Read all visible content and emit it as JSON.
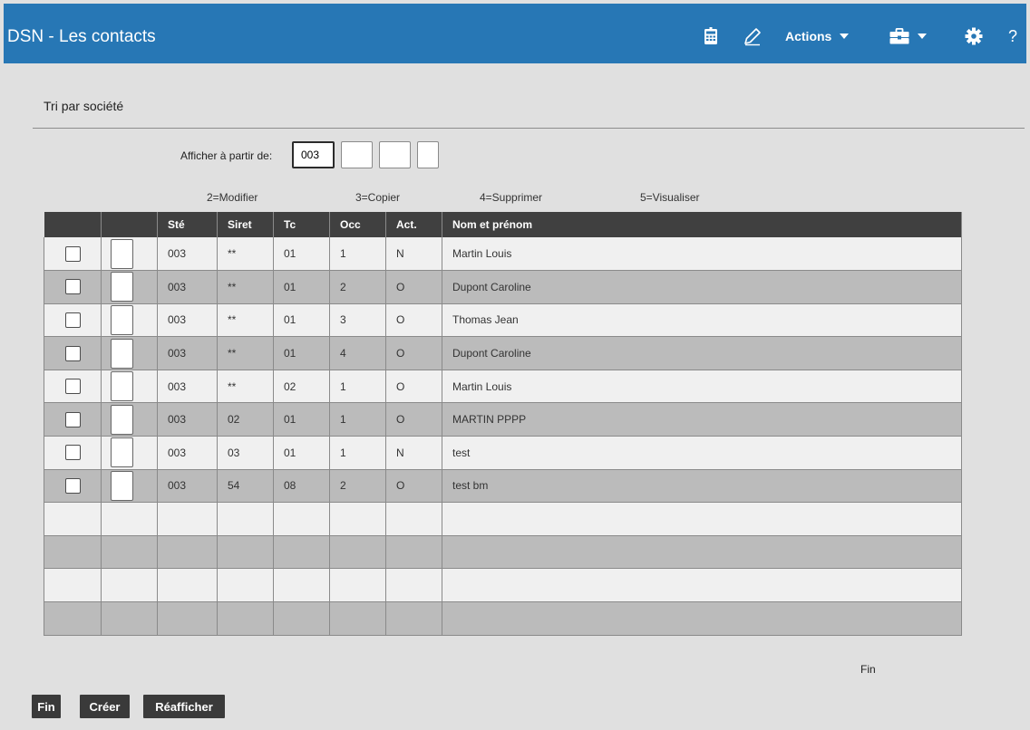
{
  "header": {
    "title": "DSN - Les contacts",
    "icons": [
      "calculator-icon",
      "edit-pencil-icon",
      "toolbox-icon",
      "gear-icon"
    ],
    "actions_label": "Actions",
    "help_label": "?"
  },
  "section_title": "Tri par société",
  "filter": {
    "label": "Afficher à partir de:",
    "value": "003"
  },
  "legend": {
    "modify": "2=Modifier",
    "copy": "3=Copier",
    "delete": "4=Supprimer",
    "view": "5=Visualiser"
  },
  "table": {
    "columns": [
      "",
      "",
      "Sté",
      "Siret",
      "Tc",
      "Occ",
      "Act.",
      "Nom et prénom"
    ],
    "rows": [
      {
        "ste": "003",
        "siret": "**",
        "tc": "01",
        "occ": "1",
        "act": "N",
        "name": "Martin Louis"
      },
      {
        "ste": "003",
        "siret": "**",
        "tc": "01",
        "occ": "2",
        "act": "O",
        "name": "Dupont Caroline"
      },
      {
        "ste": "003",
        "siret": "**",
        "tc": "01",
        "occ": "3",
        "act": "O",
        "name": "Thomas Jean"
      },
      {
        "ste": "003",
        "siret": "**",
        "tc": "01",
        "occ": "4",
        "act": "O",
        "name": "Dupont Caroline"
      },
      {
        "ste": "003",
        "siret": "**",
        "tc": "02",
        "occ": "1",
        "act": "O",
        "name": "Martin Louis"
      },
      {
        "ste": "003",
        "siret": "02",
        "tc": "01",
        "occ": "1",
        "act": "O",
        "name": "MARTIN PPPP"
      },
      {
        "ste": "003",
        "siret": "03",
        "tc": "01",
        "occ": "1",
        "act": "N",
        "name": "test"
      },
      {
        "ste": "003",
        "siret": "54",
        "tc": "08",
        "occ": "2",
        "act": "O",
        "name": "test bm"
      }
    ]
  },
  "footer": {
    "end_label": "Fin",
    "buttons": {
      "fin": "Fin",
      "create": "Créer",
      "refresh": "Réafficher"
    }
  },
  "colors": {
    "header_bg": "#2777b5",
    "table_header_bg": "#404040",
    "row_light": "#f0f0f0",
    "row_dark": "#bbbbbb",
    "page_bg": "#e0e0e0"
  }
}
